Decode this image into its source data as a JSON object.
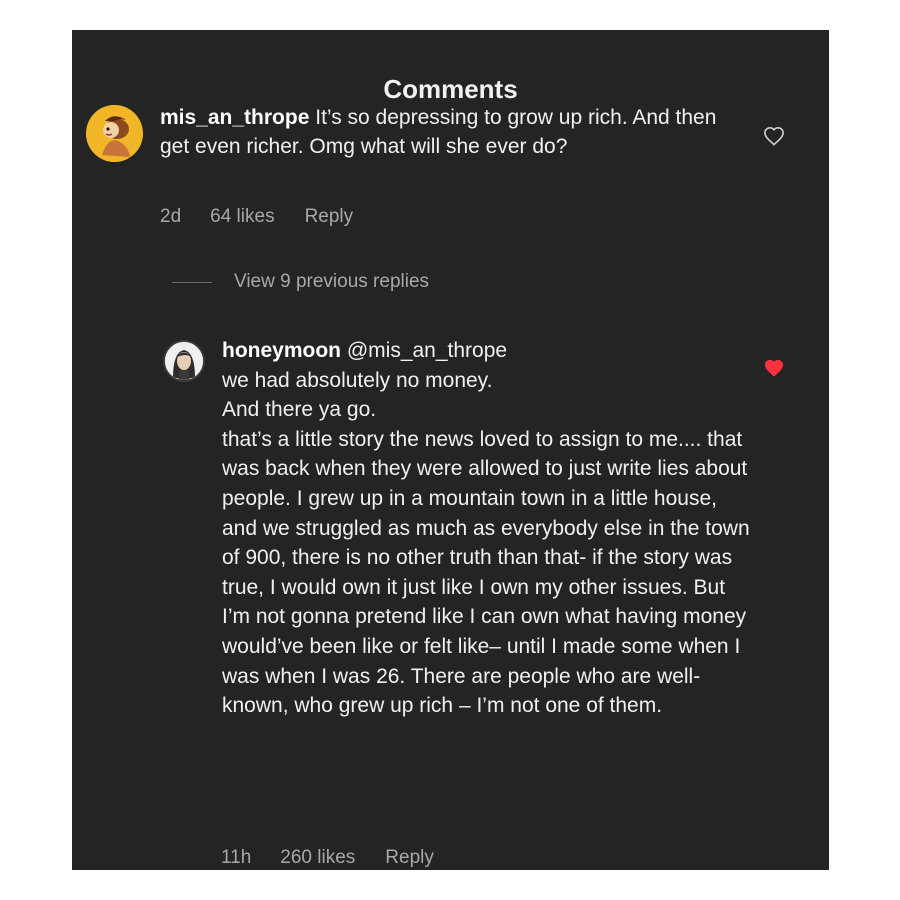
{
  "header": {
    "title": "Comments"
  },
  "comments": [
    {
      "username": "mis_an_thrope",
      "text": "It’s so depressing to grow up rich. And then get even richer. Omg what will she ever do?",
      "time": "2d",
      "likes": "64 likes",
      "reply_label": "Reply",
      "liked": false,
      "avatar_icon": "cartoon-avatar-icon"
    }
  ],
  "thread": {
    "view_replies_label": "View 9 previous replies"
  },
  "replies": [
    {
      "username": "honeymoon",
      "mention": "@mis_an_thrope",
      "text": "we had absolutely no money.\nAnd there ya go.\nthat’s a little story the news loved to assign to me.... that was back when they were allowed to just write lies about people. I grew up in a mountain town in a little house, and we struggled as much as everybody else in the town of 900, there is no other truth than that- if the story was true, I would own it just like I own my other issues. But I’m not gonna pretend like I can own what having money would’ve been like or felt like– until I made some when I was when I was 26. There are people who are well-known, who grew up rich – I’m not one of them.",
      "time": "11h",
      "likes": "260 likes",
      "reply_label": "Reply",
      "liked": true,
      "avatar_icon": "profile-photo-avatar"
    }
  ],
  "colors": {
    "panel_bg": "#242424",
    "text_primary": "#f0f0f0",
    "text_secondary": "#a8a8a8",
    "heart_liked": "#ff3040"
  }
}
